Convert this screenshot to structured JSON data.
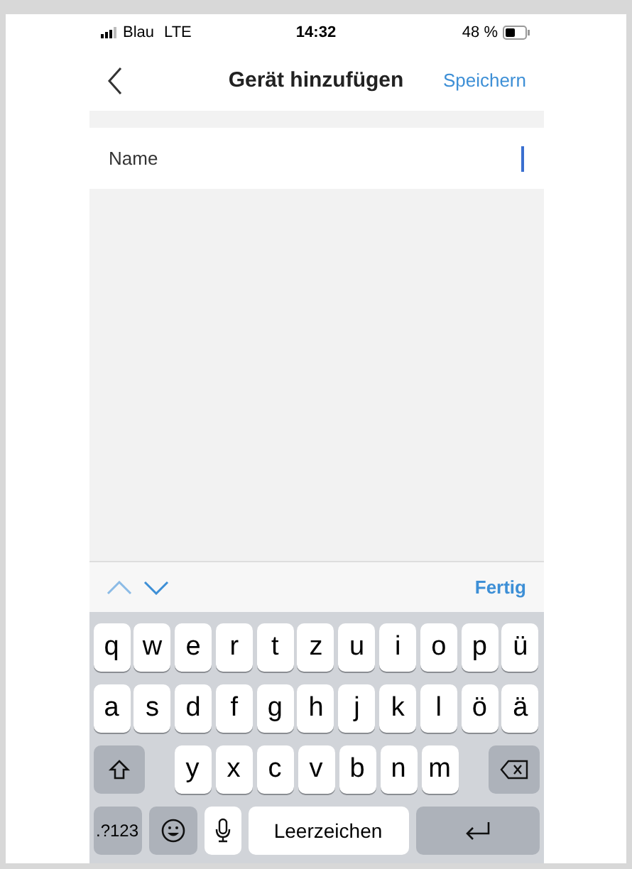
{
  "status_bar": {
    "carrier": "Blau",
    "network": "LTE",
    "time": "14:32",
    "battery": "48 %"
  },
  "nav": {
    "title": "Gerät hinzufügen",
    "action": "Speichern"
  },
  "form": {
    "field_label": "Name"
  },
  "toolbar": {
    "done": "Fertig"
  },
  "keyboard": {
    "top_keys": [
      "q",
      "w",
      "e",
      "r",
      "t",
      "z",
      "u",
      "i",
      "o",
      "p",
      "ü"
    ],
    "middle_keys": [
      "a",
      "s",
      "d",
      "f",
      "g",
      "h",
      "j",
      "k",
      "l",
      "ö",
      "ä"
    ],
    "bottom_keys": [
      "y",
      "x",
      "c",
      "v",
      "b",
      "n",
      "m"
    ],
    "numbers_key": ".?123",
    "space": "Leerzeichen"
  }
}
